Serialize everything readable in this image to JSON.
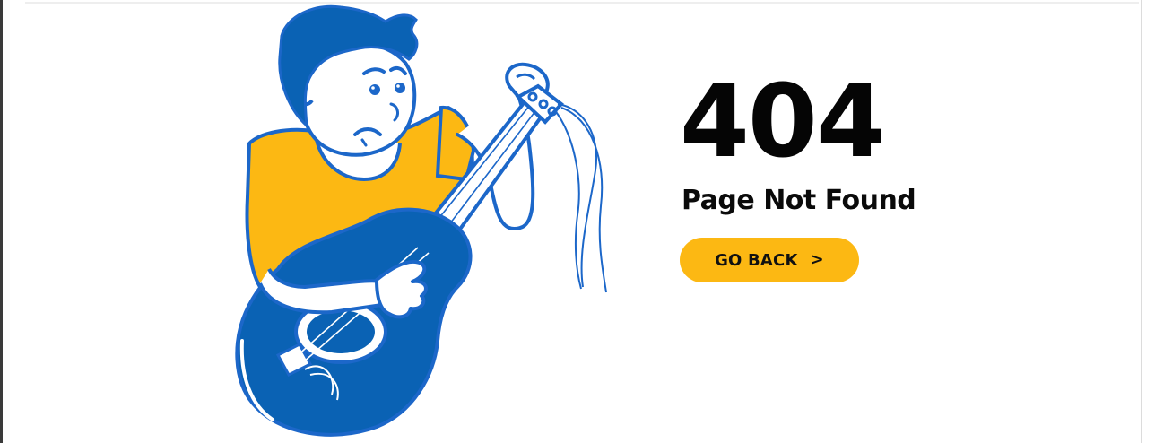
{
  "page": {
    "error_code": "404",
    "title": "Page Not Found",
    "back_button_label": "GO BACK",
    "back_button_icon": "chevron-right-icon",
    "back_button_glyph": ">"
  },
  "illustration": {
    "subject": "person-playing-guitar-with-broken-strings",
    "colors": {
      "primary_blue": "#0A62B4",
      "outline_blue": "#1C67C9",
      "shirt_yellow": "#FCB813",
      "skin_white": "#FFFFFF"
    }
  },
  "colors": {
    "accent": "#FCB813",
    "text": "#050505",
    "background": "#FFFFFF"
  }
}
